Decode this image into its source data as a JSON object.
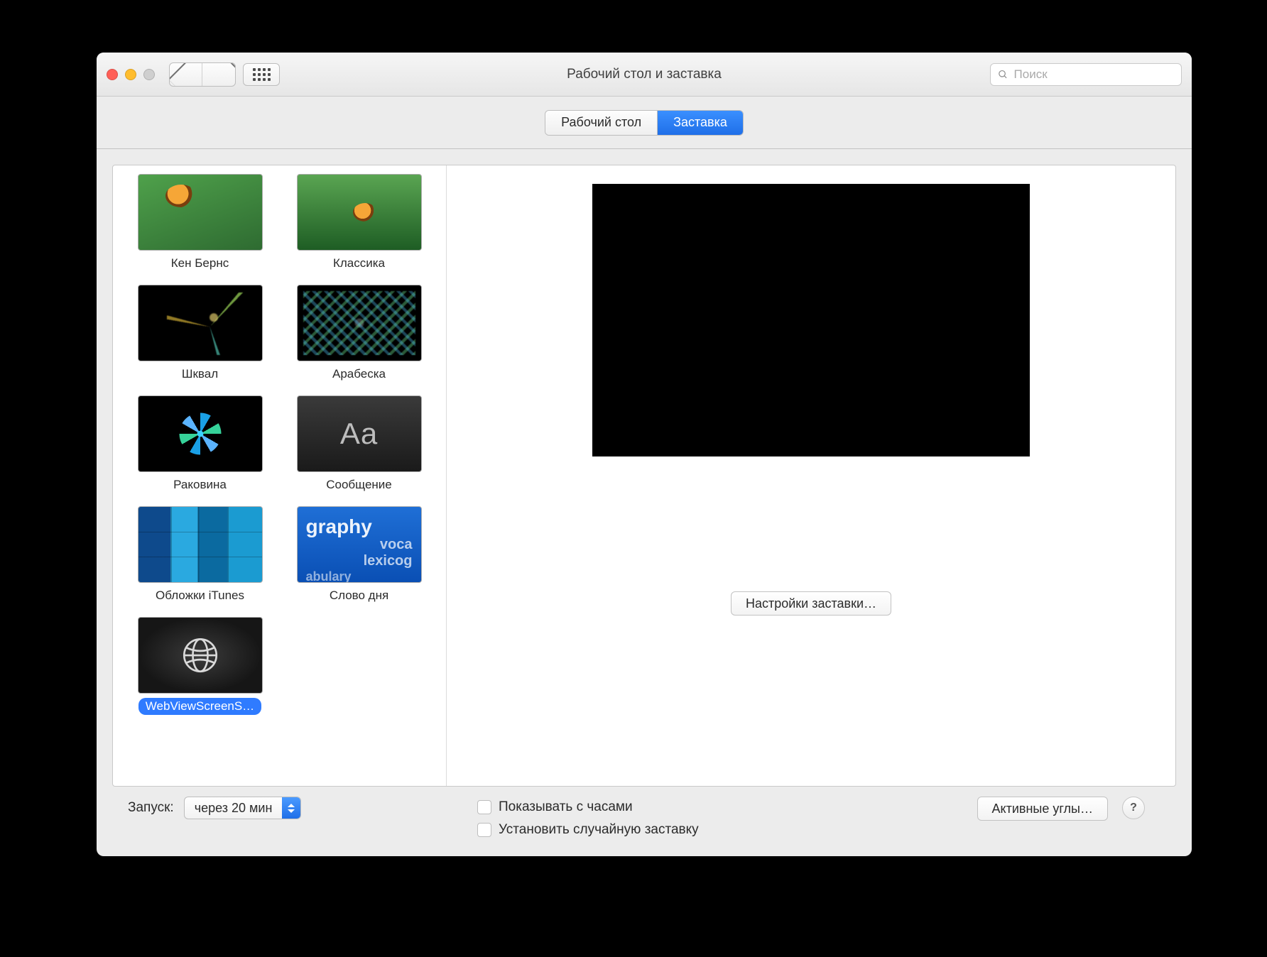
{
  "window": {
    "title": "Рабочий стол и заставка"
  },
  "search": {
    "placeholder": "Поиск",
    "value": ""
  },
  "tabs": {
    "desktop": "Рабочий стол",
    "screensaver": "Заставка",
    "active": "screensaver"
  },
  "screensavers": [
    {
      "id": "ken-burns",
      "label": "Кен Бернс",
      "selected": false
    },
    {
      "id": "classic",
      "label": "Классика",
      "selected": false
    },
    {
      "id": "flurry",
      "label": "Шквал",
      "selected": false
    },
    {
      "id": "arabesque",
      "label": "Арабеска",
      "selected": false
    },
    {
      "id": "shell",
      "label": "Раковина",
      "selected": false
    },
    {
      "id": "message",
      "label": "Сообщение",
      "glyph": "Aa",
      "selected": false
    },
    {
      "id": "itunes-artwork",
      "label": "Обложки iTunes",
      "selected": false
    },
    {
      "id": "word-of-day",
      "label": "Слово дня",
      "lines": [
        "graphy",
        "lexicog",
        "abulary",
        "voca"
      ],
      "selected": false
    },
    {
      "id": "webview",
      "label": "WebViewScreenS…",
      "selected": true
    }
  ],
  "preview": {
    "settings_button": "Настройки заставки…"
  },
  "footer": {
    "start_label": "Запуск:",
    "start_value": "через 20 мин",
    "show_with_clock": "Показывать с часами",
    "random": "Установить случайную заставку",
    "hot_corners": "Активные углы…",
    "help": "?"
  }
}
